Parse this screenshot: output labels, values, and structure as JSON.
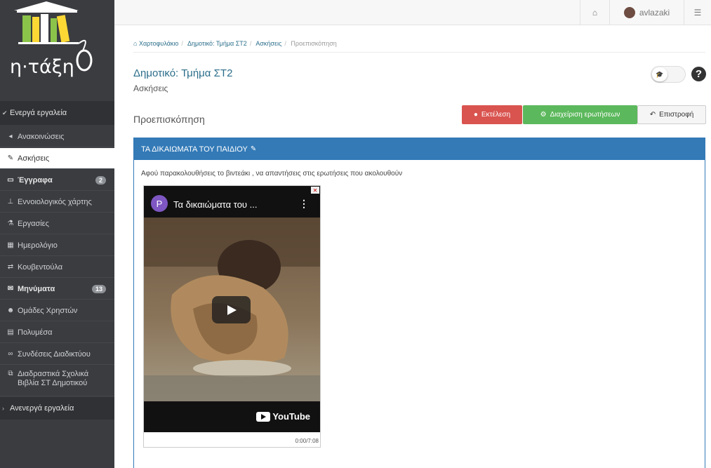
{
  "logo": {
    "text": "η·τάξη"
  },
  "topbar": {
    "home_icon": "home-icon",
    "username": "avlazaki",
    "menu_icon": "sliders-icon"
  },
  "sidebar": {
    "active_section": "Ενεργά εργαλεία",
    "items": [
      {
        "label": "Ανακοινώσεις",
        "icon": "megaphone-icon"
      },
      {
        "label": "Ασκήσεις",
        "icon": "edit-icon"
      },
      {
        "label": "Έγγραφα",
        "icon": "folder-icon",
        "badge": "2"
      },
      {
        "label": "Εννοιολογικός χάρτης",
        "icon": "sitemap-icon"
      },
      {
        "label": "Εργασίες",
        "icon": "flask-icon"
      },
      {
        "label": "Ημερολόγιο",
        "icon": "calendar-icon"
      },
      {
        "label": "Κουβεντούλα",
        "icon": "exchange-icon"
      },
      {
        "label": "Μηνύματα",
        "icon": "envelope-icon",
        "badge": "13"
      },
      {
        "label": "Ομάδες Χρηστών",
        "icon": "users-icon"
      },
      {
        "label": "Πολυμέσα",
        "icon": "film-icon"
      },
      {
        "label": "Συνδέσεις Διαδικτύου",
        "icon": "link-icon"
      },
      {
        "label": "Διαδραστικά Σχολικά Βιβλία ΣΤ Δημοτικού",
        "icon": "external-link-icon"
      }
    ],
    "inactive_section": "Ανενεργά εργαλεία"
  },
  "breadcrumb": [
    "Χαρτοφυλάκιο",
    "Δημοτικό: Τμήμα ΣΤ2",
    "Ασκήσεις",
    "Προεπισκόπηση"
  ],
  "page": {
    "title": "Δημοτικό: Τμήμα ΣΤ2",
    "subtitle": "Ασκήσεις",
    "section": "Προεπισκόπηση",
    "help": "?"
  },
  "buttons": {
    "execute": "Εκτέλεση",
    "manage": "Διαχείριση ερωτήσεων",
    "back": "Επιστροφή"
  },
  "panel": {
    "title": "ΤΑ ΔΙΚΑΙΩΜΑΤΑ ΤΟΥ ΠΑΙΔΙΟΥ",
    "instructions": "Αφού παρακολουθήσεις το βιντεάκι , να απαντήσεις στις ερωτήσεις που ακολουθούν"
  },
  "video": {
    "channel_initial": "P",
    "title": "Τα δικαιώματα του ...",
    "brand": "YouTube",
    "time": "0:00/7:08",
    "accent": "#7e57c2"
  },
  "colors": {
    "primary": "#337ab7",
    "danger": "#d9534f",
    "success": "#5cb85c",
    "link": "#2b6e8a"
  }
}
